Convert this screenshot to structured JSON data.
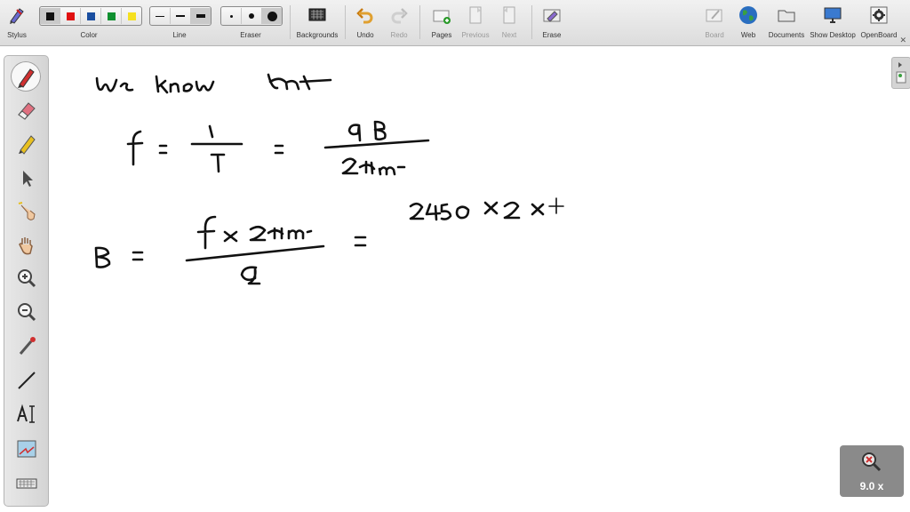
{
  "toolbar": {
    "stylus": "Stylus",
    "color": "Color",
    "line": "Line",
    "eraser": "Eraser",
    "backgrounds": "Backgrounds",
    "undo": "Undo",
    "redo": "Redo",
    "pages": "Pages",
    "previous": "Previous",
    "next": "Next",
    "erase": "Erase",
    "board": "Board",
    "web": "Web",
    "documents": "Documents",
    "show_desktop": "Show Desktop",
    "openboard": "OpenBoard",
    "colors": [
      "#111111",
      "#e01010",
      "#1a4ea0",
      "#109030",
      "#f5e020"
    ],
    "selected_color_index": 0
  },
  "zoom": {
    "label": "9.0 x"
  }
}
